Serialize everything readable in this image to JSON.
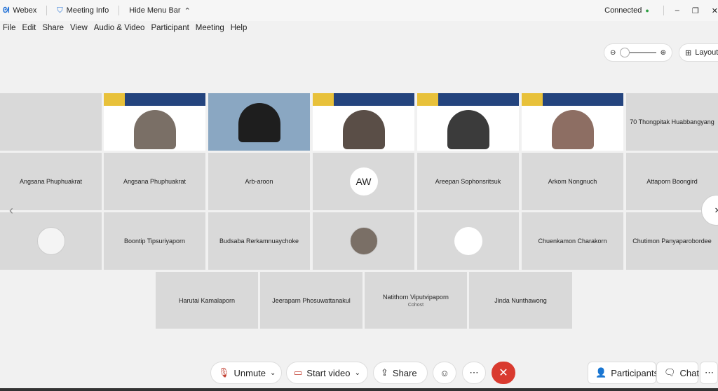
{
  "titlebar": {
    "app": "Webex",
    "meeting_info": "Meeting Info",
    "hide_menu": "Hide Menu Bar",
    "status": "Connected",
    "status_color": "#2ea043"
  },
  "menu": [
    "File",
    "Edit",
    "Share",
    "View",
    "Audio & Video",
    "Participant",
    "Meeting",
    "Help"
  ],
  "layout_label": "Layout",
  "row1_last": "70 Thongpitak Huabbangyang",
  "row2": [
    "Angsana Phuphuakrat",
    "Angsana Phuphuakrat",
    "Arb-aroon",
    "AW",
    "Areepan Sophonsritsuk",
    "Arkom Nongnuch",
    "Attaporn Boongird"
  ],
  "row3": [
    "",
    "Boontip Tipsuriyaporn",
    "Budsaba Rerkamnuaychoke",
    "",
    "",
    "Chuenkamon Charakorn",
    "Chutimon Panyaparobordee"
  ],
  "row4": [
    "Harutai Kamalaporn",
    "Jeeraparn Phosuwattanakul",
    "Natithorn Viputvipaporn",
    "Jinda Nunthawong"
  ],
  "cohost_label": "Cohost",
  "toolbar": {
    "unmute": "Unmute",
    "start_video": "Start video",
    "share": "Share",
    "participants": "Participants",
    "chat": "Chat"
  }
}
